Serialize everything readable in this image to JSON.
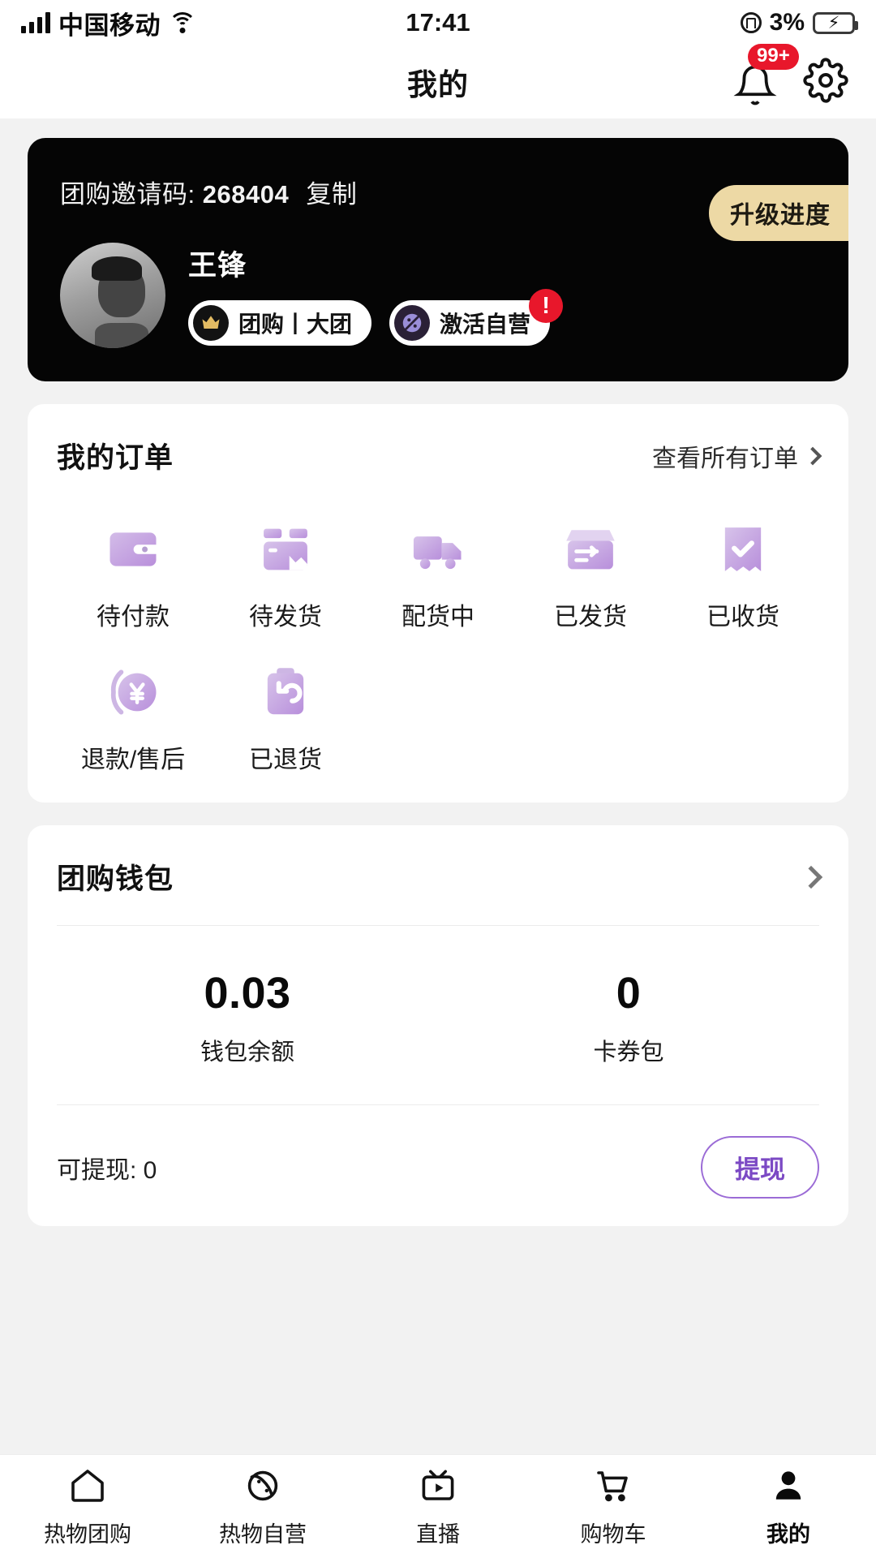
{
  "status_bar": {
    "carrier": "中国移动",
    "wifi_icon": "wifi-icon",
    "signal_icon": "signal-bars-icon",
    "time": "17:41",
    "lock_icon": "rotation-lock-icon",
    "battery_percent": "3%",
    "battery_icon": "battery-charging-icon"
  },
  "header": {
    "title": "我的",
    "bell_icon": "bell-icon",
    "notification_badge": "99+",
    "settings_icon": "gear-icon"
  },
  "profile": {
    "invite_label": "团购邀请码:",
    "invite_code": "268404",
    "copy_label": "复制",
    "upgrade_label": "升级进度",
    "avatar_icon": "avatar",
    "username": "王锋",
    "chips": [
      {
        "icon": "crown-icon",
        "label": "团购丨大团",
        "alert": ""
      },
      {
        "icon": "self-operated-icon",
        "label": "激活自营",
        "alert": "!"
      }
    ]
  },
  "orders": {
    "title": "我的订单",
    "more_label": "查看所有订单",
    "more_icon": "chevron-right-icon",
    "items": [
      {
        "icon": "wallet-icon",
        "label": "待付款"
      },
      {
        "icon": "box-icon",
        "label": "待发货"
      },
      {
        "icon": "truck-icon",
        "label": "配货中"
      },
      {
        "icon": "shipped-icon",
        "label": "已发货"
      },
      {
        "icon": "received-icon",
        "label": "已收货"
      },
      {
        "icon": "refund-icon",
        "label": "退款/售后"
      },
      {
        "icon": "returned-icon",
        "label": "已退货"
      }
    ]
  },
  "wallet": {
    "title": "团购钱包",
    "chevron_icon": "chevron-right-icon",
    "stats": [
      {
        "value": "0.03",
        "label": "钱包余额"
      },
      {
        "value": "0",
        "label": "卡券包"
      }
    ],
    "withdrawable_label": "可提现: 0",
    "withdraw_button": "提现"
  },
  "tabbar": {
    "items": [
      {
        "icon": "home-icon",
        "label": "热物团购",
        "active": false
      },
      {
        "icon": "planet-icon",
        "label": "热物自营",
        "active": false
      },
      {
        "icon": "tv-play-icon",
        "label": "直播",
        "active": false
      },
      {
        "icon": "cart-icon",
        "label": "购物车",
        "active": false
      },
      {
        "icon": "person-icon",
        "label": "我的",
        "active": true
      }
    ]
  },
  "colors": {
    "accent_purple": "#b48de0",
    "brand_dark": "#050505",
    "alert_red": "#e8172b",
    "upgrade_gold": "#edd9a5",
    "withdraw_purple": "#7b49c4"
  }
}
